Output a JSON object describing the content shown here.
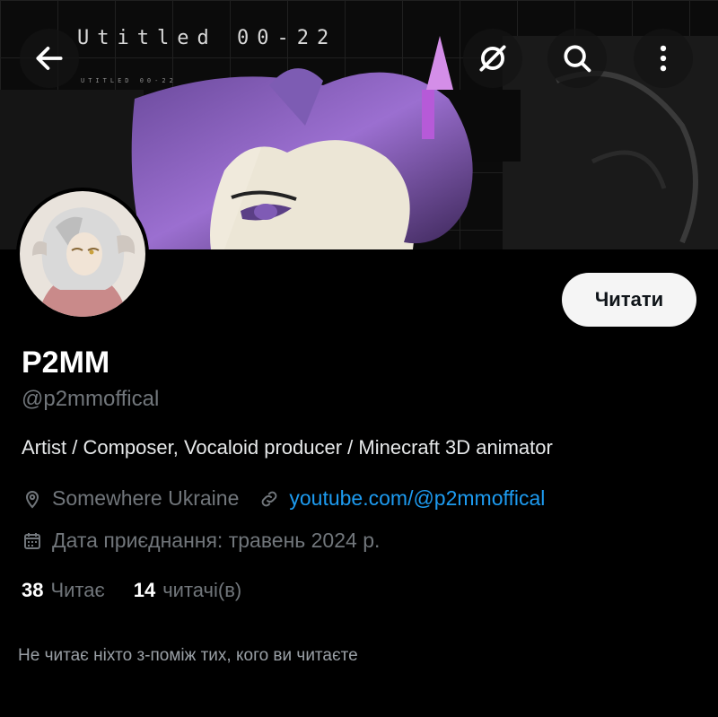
{
  "header": {
    "banner_caption": "Utitled 00-22",
    "banner_caption_small": "UTITLED        00-22",
    "back_icon": "arrow-left-icon",
    "grok_icon": "slashed-circle-icon",
    "search_icon": "search-icon",
    "more_icon": "more-vertical-icon"
  },
  "profile": {
    "follow_label": "Читати",
    "display_name": "P2MM",
    "handle": "@p2mmoffical",
    "bio": "Artist / Composer, Vocaloid producer / Minecraft 3D animator",
    "location": "Somewhere Ukraine",
    "website": "youtube.com/@p2mmoffical",
    "joined": "Дата приєднання: травень 2024 р.",
    "following_count": "38",
    "following_label": "Читає",
    "followers_count": "14",
    "followers_label": "читачі(в)",
    "followed_by_note": "Не читає ніхто з-поміж тих, кого ви читаєте"
  },
  "colors": {
    "background": "#000000",
    "text_primary": "#e7e9ea",
    "text_secondary": "#71767b",
    "link": "#1d9bf0",
    "button_bg": "#f5f5f5"
  }
}
